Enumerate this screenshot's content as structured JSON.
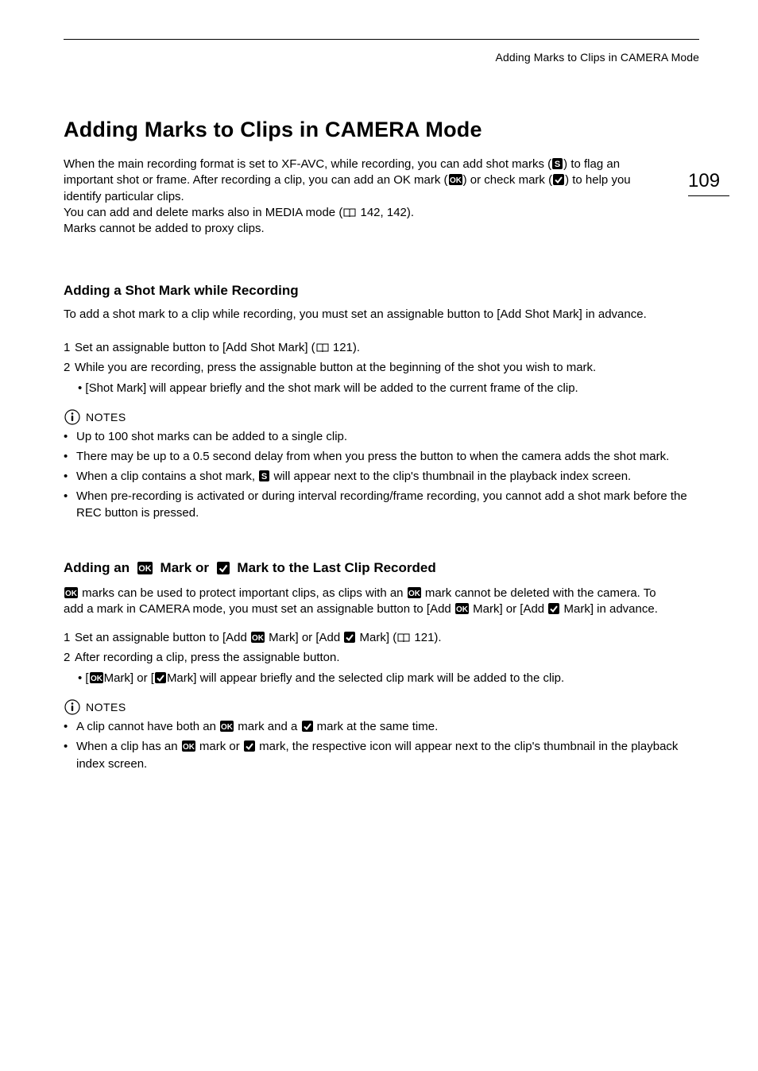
{
  "running_head": "Adding Marks to Clips in CAMERA Mode",
  "page_number": "109",
  "title": "Adding Marks to Clips in CAMERA Mode",
  "intro": {
    "l1a": "When the main recording format is set to XF-AVC, while recording, you can add shot marks (",
    "l1b": ") to flag an",
    "l2a": "important shot or frame. After recording a clip, you can add an OK mark (",
    "l2b": ") or check mark (",
    "l2c": ") to help you",
    "l3": "identify particular clips.",
    "l4a": "You can add and delete marks also in MEDIA mode (",
    "l4b": " 142, 142).",
    "l5": "Marks cannot be added to proxy clips."
  },
  "section1": {
    "heading": "Adding a Shot Mark while Recording",
    "lead": "To add a shot mark to a clip while recording, you must set an assignable button to [Add Shot Mark] in advance.",
    "step1a": "Set an assignable button to [Add Shot Mark] (",
    "step1b": " 121).",
    "step2": "While you are recording, press the assignable button at the beginning of the shot you wish to mark.",
    "step2sub": "[Shot Mark] will appear briefly and the shot mark will be added to the current frame of the clip.",
    "notes_label": "NOTES",
    "n1": "Up to 100 shot marks can be added to a single clip.",
    "n2": "There may be up to a 0.5 second delay from when you press the button to when the camera adds the shot mark.",
    "n3a": "When a clip contains a shot mark, ",
    "n3b": " will appear next to the clip's thumbnail in the playback index screen.",
    "n4": "When pre-recording is activated or during interval recording/frame recording, you cannot add a shot mark before the REC button is pressed."
  },
  "section2": {
    "h_a": "Adding an ",
    "h_b": " Mark or ",
    "h_c": " Mark to the Last Clip Recorded",
    "p1a": " marks can be used to protect important clips, as clips with an ",
    "p1b": " mark cannot be deleted with the camera.",
    "p2a": "To add a mark in CAMERA mode, you must set an assignable button to [Add ",
    "p2b": " Mark] or [Add ",
    "p2c": " Mark] in",
    "p3": "advance.",
    "step1a": "Set an assignable button to [Add ",
    "step1b": " Mark] or [Add ",
    "step1c": " Mark] (",
    "step1d": " 121).",
    "step2": "After recording a clip, press the assignable button.",
    "step2suba": "[",
    "step2subb": "Mark] or [",
    "step2subc": "Mark] will appear briefly and the selected clip mark will be added to the clip.",
    "notes_label": "NOTES",
    "n1a": "A clip cannot have both an ",
    "n1b": " mark and a ",
    "n1c": " mark at the same time.",
    "n2a": "When a clip has an ",
    "n2b": " mark or ",
    "n2c": " mark, the respective icon will appear next to the clip's thumbnail in the playback index screen."
  }
}
